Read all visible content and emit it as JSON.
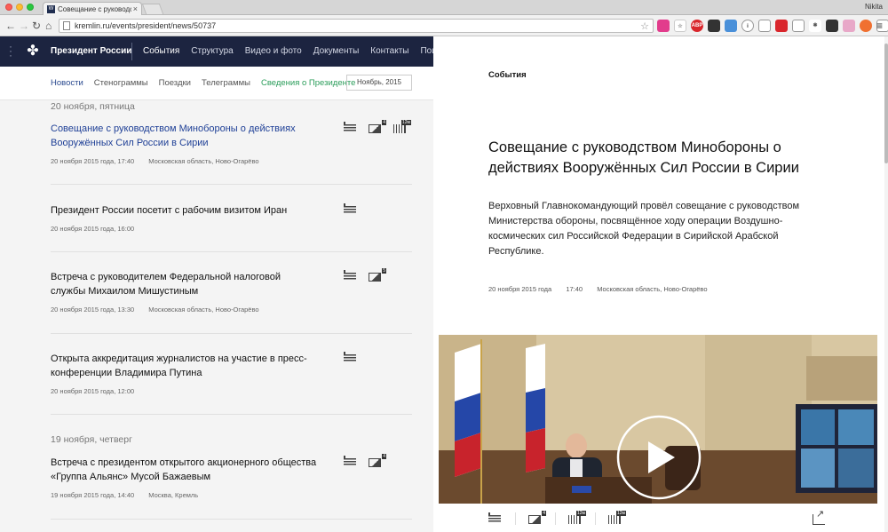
{
  "browser": {
    "tab_title": "Совещание с руководств",
    "tab_favicon": "кремль-icon",
    "url": "kremlin.ru/events/president/news/50737",
    "user": "Nikita"
  },
  "site": {
    "brand": "Президент России",
    "nav": [
      "События",
      "Структура",
      "Видео и фото",
      "Документы",
      "Контакты",
      "Поиск"
    ],
    "subnav": [
      "Новости",
      "Стенограммы",
      "Поездки",
      "Телеграммы",
      "Сведения о Президенте"
    ],
    "date_picker": "Ноябрь, 2015"
  },
  "news": {
    "day1": "20 ноября, пятница",
    "day2": "19 ноября, четверг",
    "items": [
      {
        "title": "Совещание с руководством Минобороны о действиях Вооружённых Сил России в Сирии",
        "date": "20 ноября 2015 года, 17:40",
        "place": "Московская область, Ново-Огарёво",
        "photo_count": "4",
        "video_label": "12м"
      },
      {
        "title": "Президент России посетит с рабочим визитом Иран",
        "date": "20 ноября 2015 года, 16:00",
        "place": ""
      },
      {
        "title": "Встреча с руководителем Федеральной налоговой службы Михаилом Мишустиным",
        "date": "20 ноября 2015 года, 13:30",
        "place": "Московская область, Ново-Огарёво",
        "photo_count": "5"
      },
      {
        "title": "Открыта аккредитация журналистов на участие в пресс-конференции Владимира Путина",
        "date": "20 ноября 2015 года, 12:00",
        "place": ""
      },
      {
        "title": "Встреча с президентом открытого акционерного общества «Группа Альянс» Мусой Бажаевым",
        "date": "19 ноября 2015 года, 14:40",
        "place": "Москва, Кремль",
        "photo_count": "4"
      }
    ]
  },
  "article": {
    "section": "События",
    "title": "Совещание с руководством Минобороны о действиях Вооружённых Сил России в Сирии",
    "lead": "Верховный Главнокомандующий провёл совещание с руководством Министерства обороны, посвящённое ходу операции Воздушно-космических сил Российской Федерации в Сирийской Арабской Республике.",
    "date": "20 ноября 2015 года",
    "time": "17:40",
    "place": "Московская область, Ново-Огарёво",
    "tool_photo_count": "4",
    "tool_video1": "12м",
    "tool_video2": "12м"
  }
}
